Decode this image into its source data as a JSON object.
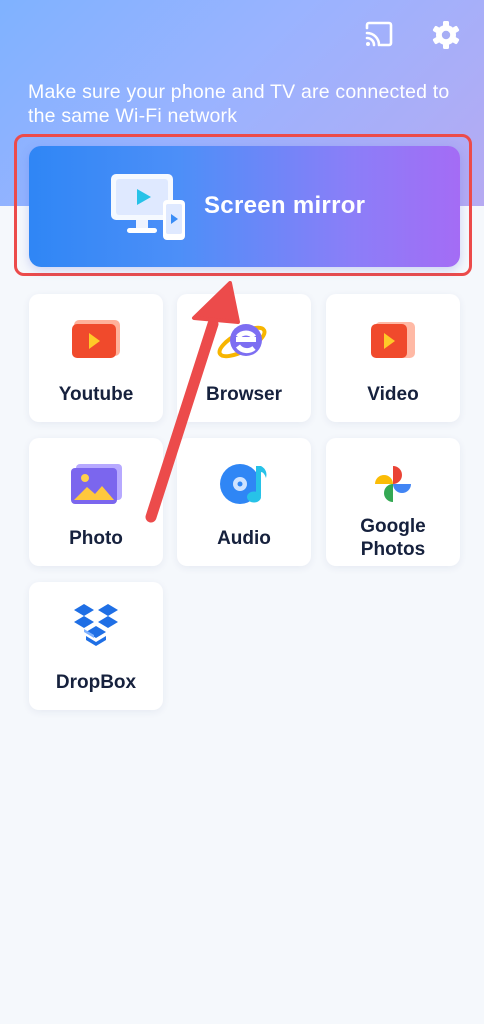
{
  "colors": {
    "header_gradient": [
      "#7fb2ff",
      "#b6aaf2"
    ],
    "mirror_gradient": [
      "#2f86f5",
      "#a46cf5"
    ],
    "highlight_box": "#ec4b4b",
    "annotation_arrow": "#ec4b4b",
    "tile_label": "#16213d",
    "page_background": "#f5f8fc"
  },
  "header": {
    "icons": [
      "cast-icon",
      "settings-gear-icon"
    ],
    "hint": "Make sure your phone and TV are connected to the same Wi-Fi network"
  },
  "mirror": {
    "label": "Screen mirror",
    "icon": "monitor-phone-play-icon"
  },
  "tiles": [
    {
      "label": "Youtube",
      "icon": "youtube-icon"
    },
    {
      "label": "Browser",
      "icon": "browser-e-icon"
    },
    {
      "label": "Video",
      "icon": "video-icon"
    },
    {
      "label": "Photo",
      "icon": "photo-icon"
    },
    {
      "label": "Audio",
      "icon": "audio-icon"
    },
    {
      "label": "Google Photos",
      "icon": "google-photos-icon"
    },
    {
      "label": "DropBox",
      "icon": "dropbox-icon"
    }
  ],
  "annotation": {
    "type": "red-arrow-pointing-to-screen-mirror",
    "highlight": "red-box-around-screen-mirror"
  }
}
